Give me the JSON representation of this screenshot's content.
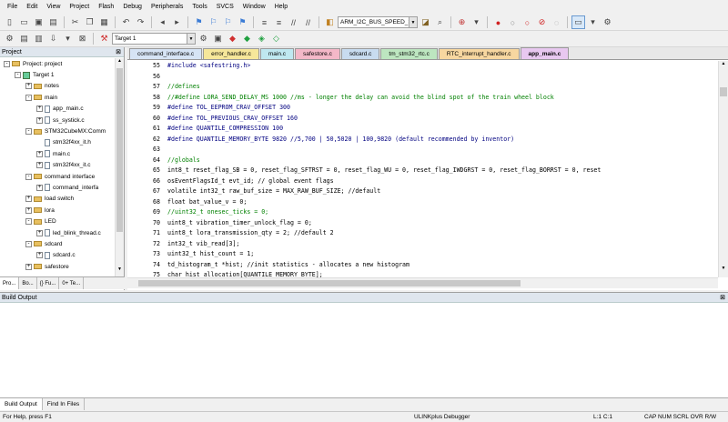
{
  "menu": [
    "File",
    "Edit",
    "View",
    "Project",
    "Flash",
    "Debug",
    "Peripherals",
    "Tools",
    "SVCS",
    "Window",
    "Help"
  ],
  "toolbar": {
    "search_combo": "ARM_I2C_BUS_SPEED_ST",
    "target_combo": "Target 1"
  },
  "project_panel": {
    "title": "Project",
    "tree": [
      {
        "label": "Project: project",
        "level": 0,
        "kind": "root",
        "exp": "-"
      },
      {
        "label": "Target 1",
        "level": 1,
        "kind": "target",
        "exp": "-"
      },
      {
        "label": "notes",
        "level": 2,
        "kind": "folder",
        "exp": "+"
      },
      {
        "label": "main",
        "level": 2,
        "kind": "folder",
        "exp": "-"
      },
      {
        "label": "app_main.c",
        "level": 3,
        "kind": "file",
        "exp": "+"
      },
      {
        "label": "ss_systick.c",
        "level": 3,
        "kind": "file",
        "exp": "+"
      },
      {
        "label": "STM32CubeMX:Comm",
        "level": 2,
        "kind": "folder",
        "exp": "-"
      },
      {
        "label": "stm32f4xx_it.h",
        "level": 3,
        "kind": "file",
        "exp": ""
      },
      {
        "label": "main.c",
        "level": 3,
        "kind": "file",
        "exp": "+"
      },
      {
        "label": "stm32f4xx_it.c",
        "level": 3,
        "kind": "file",
        "exp": "+"
      },
      {
        "label": "command interface",
        "level": 2,
        "kind": "folder",
        "exp": "-"
      },
      {
        "label": "command_interfa",
        "level": 3,
        "kind": "file",
        "exp": "+"
      },
      {
        "label": "load switch",
        "level": 2,
        "kind": "folder",
        "exp": "+"
      },
      {
        "label": "lora",
        "level": 2,
        "kind": "folder",
        "exp": "+"
      },
      {
        "label": "LED",
        "level": 2,
        "kind": "folder",
        "exp": "-"
      },
      {
        "label": "led_blink_thread.c",
        "level": 3,
        "kind": "file",
        "exp": "+"
      },
      {
        "label": "sdcard",
        "level": 2,
        "kind": "folder",
        "exp": "-"
      },
      {
        "label": "sdcard.c",
        "level": 3,
        "kind": "file",
        "exp": "+"
      },
      {
        "label": "safestore",
        "level": 2,
        "kind": "folder",
        "exp": "+"
      }
    ],
    "tabs": [
      "Pro...",
      "Bo...",
      "{} Fu...",
      "0+ Te..."
    ]
  },
  "editor": {
    "tabs": [
      {
        "label": "command_interface.c",
        "color": "#d6e4f5"
      },
      {
        "label": "error_handler.c",
        "color": "#f6e79a"
      },
      {
        "label": "main.c",
        "color": "#bfe8f0"
      },
      {
        "label": "safestore.c",
        "color": "#f4b8c8"
      },
      {
        "label": "sdcard.c",
        "color": "#c8dcf0"
      },
      {
        "label": "tm_stm32_rtc.c",
        "color": "#bde6c0"
      },
      {
        "label": "RTC_interrupt_handler.c",
        "color": "#f7d7a0"
      },
      {
        "label": "app_main.c",
        "color": "#e8c8f0"
      }
    ],
    "lines": [
      {
        "n": "55",
        "t": "#include <safestring.h>",
        "c": "pp"
      },
      {
        "n": "56",
        "t": "",
        "c": ""
      },
      {
        "n": "57",
        "t": "//defines",
        "c": "com"
      },
      {
        "n": "58",
        "t": "//#define LORA_SEND_DELAY_MS 1000 //ms - longer the delay can avoid the blind spot of the train wheel block",
        "c": "com"
      },
      {
        "n": "59",
        "t": "#define TOL_EEPROM_CRAV_OFFSET 300",
        "c": "pp"
      },
      {
        "n": "60",
        "t": "#define TOL_PREVIOUS_CRAV_OFFSET 160",
        "c": "pp"
      },
      {
        "n": "61",
        "t": "#define QUANTILE_COMPRESSION 100",
        "c": "pp"
      },
      {
        "n": "62",
        "t": "#define QUANTILE_MEMORY_BYTE 9820 //5,700 | 50,5020 | 100,9820 (default recommended by inventor)",
        "c": "pp"
      },
      {
        "n": "63",
        "t": "",
        "c": ""
      },
      {
        "n": "64",
        "t": "//globals",
        "c": "com"
      },
      {
        "n": "65",
        "t": "int8_t reset_flag_SB = 0, reset_flag_SFTRST = 0, reset_flag_WU = 0, reset_flag_IWDGRST = 0, reset_flag_BORRST = 0, reset",
        "c": ""
      },
      {
        "n": "66",
        "t": "osEventFlagsId_t evt_id; // global event flags",
        "c": ""
      },
      {
        "n": "67",
        "t": "volatile int32_t raw_buf_size = MAX_RAW_BUF_SIZE; //default",
        "c": ""
      },
      {
        "n": "68",
        "t": "float bat_value_v = 0;",
        "c": ""
      },
      {
        "n": "69",
        "t": "//uint32_t onesec_ticks = 0;",
        "c": "com"
      },
      {
        "n": "70",
        "t": "uint8_t vibration_timer_unlock_flag = 0;",
        "c": ""
      },
      {
        "n": "71",
        "t": "uint8_t lora_transmission_qty = 2; //default 2",
        "c": ""
      },
      {
        "n": "72",
        "t": "int32_t vib_read[3];",
        "c": ""
      },
      {
        "n": "73",
        "t": "uint32_t hist_count = 1;",
        "c": ""
      },
      {
        "n": "74",
        "t": "td_histogram_t *hist; //init statistics - allocates a new histogram",
        "c": ""
      },
      {
        "n": "75",
        "t": "char hist_allocation[QUANTILE_MEMORY_BYTE];",
        "c": ""
      },
      {
        "n": "76",
        "t": "//uint32_t test_quantile_peak; //??????????????",
        "c": "com"
      },
      {
        "n": "77",
        "t": "//float test_thresh_quantile_peak; //??????????????",
        "c": "com"
      },
      {
        "n": "78",
        "t": "//uint_t test_theoretical_thresh; //??????????????",
        "c": "com"
      }
    ]
  },
  "build_panel": {
    "title": "Build Output",
    "tabs": [
      "Build Output",
      "Find In Files"
    ]
  },
  "status": {
    "help": "For Help, press F1",
    "debugger": "ULINKplus Debugger",
    "cursor": "L:1 C:1",
    "flags": "CAP  NUM  SCRL  OVR  R/W"
  }
}
